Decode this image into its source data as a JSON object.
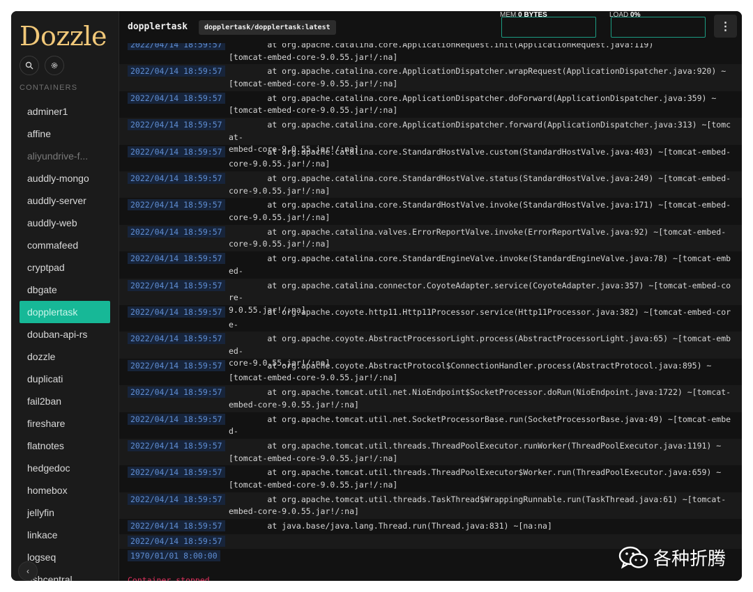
{
  "app": {
    "logo": "Dozzle"
  },
  "sidebar": {
    "section_label": "CONTAINERS",
    "items": [
      {
        "label": "adminer1",
        "state": "normal"
      },
      {
        "label": "affine",
        "state": "normal"
      },
      {
        "label": "aliyundrive-f...",
        "state": "dim"
      },
      {
        "label": "auddly-mongo",
        "state": "normal"
      },
      {
        "label": "auddly-server",
        "state": "normal"
      },
      {
        "label": "auddly-web",
        "state": "normal"
      },
      {
        "label": "commafeed",
        "state": "normal"
      },
      {
        "label": "cryptpad",
        "state": "normal"
      },
      {
        "label": "dbgate",
        "state": "normal"
      },
      {
        "label": "dopplertask",
        "state": "active"
      },
      {
        "label": "douban-api-rs",
        "state": "normal"
      },
      {
        "label": "dozzle",
        "state": "normal"
      },
      {
        "label": "duplicati",
        "state": "normal"
      },
      {
        "label": "fail2ban",
        "state": "normal"
      },
      {
        "label": "fireshare",
        "state": "normal"
      },
      {
        "label": "flatnotes",
        "state": "normal"
      },
      {
        "label": "hedgedoc",
        "state": "normal"
      },
      {
        "label": "homebox",
        "state": "normal"
      },
      {
        "label": "jellyfin",
        "state": "normal"
      },
      {
        "label": "linkace",
        "state": "normal"
      },
      {
        "label": "logseq",
        "state": "normal"
      },
      {
        "label": "eshcentral",
        "state": "normal"
      }
    ],
    "collapse_icon": "chevron-left-icon"
  },
  "header": {
    "container_name": "dopplertask",
    "image_tag": "dopplertask/dopplertask:latest",
    "mem_label": "MEM",
    "mem_value": "0 BYTES",
    "load_label": "LOAD",
    "load_value": "0%",
    "menu_icon": "vertical-dots-icon"
  },
  "logs": [
    {
      "ts": "2022/04/14 18:59:57",
      "msg": "        at org.apache.catalina.core.ApplicationRequest.init(ApplicationRequest.java:119)\n[tomcat-embed-core-9.0.55.jar!/:na]"
    },
    {
      "ts": "2022/04/14 18:59:57",
      "msg": "        at org.apache.catalina.core.ApplicationDispatcher.wrapRequest(ApplicationDispatcher.java:920) ~\n[tomcat-embed-core-9.0.55.jar!/:na]"
    },
    {
      "ts": "2022/04/14 18:59:57",
      "msg": "        at org.apache.catalina.core.ApplicationDispatcher.doForward(ApplicationDispatcher.java:359) ~\n[tomcat-embed-core-9.0.55.jar!/:na]"
    },
    {
      "ts": "2022/04/14 18:59:57",
      "msg": "        at org.apache.catalina.core.ApplicationDispatcher.forward(ApplicationDispatcher.java:313) ~[tomcat-\nembed-core-9.0.55.jar!/:na]"
    },
    {
      "ts": "2022/04/14 18:59:57",
      "msg": "        at org.apache.catalina.core.StandardHostValve.custom(StandardHostValve.java:403) ~[tomcat-embed-\ncore-9.0.55.jar!/:na]"
    },
    {
      "ts": "2022/04/14 18:59:57",
      "msg": "        at org.apache.catalina.core.StandardHostValve.status(StandardHostValve.java:249) ~[tomcat-embed-\ncore-9.0.55.jar!/:na]"
    },
    {
      "ts": "2022/04/14 18:59:57",
      "msg": "        at org.apache.catalina.core.StandardHostValve.invoke(StandardHostValve.java:171) ~[tomcat-embed-\ncore-9.0.55.jar!/:na]"
    },
    {
      "ts": "2022/04/14 18:59:57",
      "msg": "        at org.apache.catalina.valves.ErrorReportValve.invoke(ErrorReportValve.java:92) ~[tomcat-embed-\ncore-9.0.55.jar!/:na]"
    },
    {
      "ts": "2022/04/14 18:59:57",
      "msg": "        at org.apache.catalina.core.StandardEngineValve.invoke(StandardEngineValve.java:78) ~[tomcat-embed-\ncore-9.0.55.jar!/:na]"
    },
    {
      "ts": "2022/04/14 18:59:57",
      "msg": "        at org.apache.catalina.connector.CoyoteAdapter.service(CoyoteAdapter.java:357) ~[tomcat-embed-core-\n9.0.55.jar!/:na]"
    },
    {
      "ts": "2022/04/14 18:59:57",
      "msg": "        at org.apache.coyote.http11.Http11Processor.service(Http11Processor.java:382) ~[tomcat-embed-core-\n9.0.55.jar!/:na]"
    },
    {
      "ts": "2022/04/14 18:59:57",
      "msg": "        at org.apache.coyote.AbstractProcessorLight.process(AbstractProcessorLight.java:65) ~[tomcat-embed-\ncore-9.0.55.jar!/:na]"
    },
    {
      "ts": "2022/04/14 18:59:57",
      "msg": "        at org.apache.coyote.AbstractProtocol$ConnectionHandler.process(AbstractProtocol.java:895) ~\n[tomcat-embed-core-9.0.55.jar!/:na]"
    },
    {
      "ts": "2022/04/14 18:59:57",
      "msg": "        at org.apache.tomcat.util.net.NioEndpoint$SocketProcessor.doRun(NioEndpoint.java:1722) ~[tomcat-\nembed-core-9.0.55.jar!/:na]"
    },
    {
      "ts": "2022/04/14 18:59:57",
      "msg": "        at org.apache.tomcat.util.net.SocketProcessorBase.run(SocketProcessorBase.java:49) ~[tomcat-embed-\ncore-9.0.55.jar!/:na]"
    },
    {
      "ts": "2022/04/14 18:59:57",
      "msg": "        at org.apache.tomcat.util.threads.ThreadPoolExecutor.runWorker(ThreadPoolExecutor.java:1191) ~\n[tomcat-embed-core-9.0.55.jar!/:na]"
    },
    {
      "ts": "2022/04/14 18:59:57",
      "msg": "        at org.apache.tomcat.util.threads.ThreadPoolExecutor$Worker.run(ThreadPoolExecutor.java:659) ~\n[tomcat-embed-core-9.0.55.jar!/:na]"
    },
    {
      "ts": "2022/04/14 18:59:57",
      "msg": "        at org.apache.tomcat.util.threads.TaskThread$WrappingRunnable.run(TaskThread.java:61) ~[tomcat-\nembed-core-9.0.55.jar!/:na]"
    },
    {
      "ts": "2022/04/14 18:59:57",
      "msg": "        at java.base/java.lang.Thread.run(Thread.java:831) ~[na:na]"
    },
    {
      "ts": "2022/04/14 18:59:57",
      "msg": ""
    },
    {
      "ts": "1970/01/01 8:00:00",
      "msg": ""
    }
  ],
  "status": {
    "stopped_text": "Container stopped"
  },
  "watermark": {
    "text": "各种折腾",
    "icon": "wechat-icon"
  },
  "colors": {
    "accent": "#17b897",
    "logo": "#f1c879",
    "timestamp": "#5f8ed4",
    "stopped": "#e0325f"
  }
}
